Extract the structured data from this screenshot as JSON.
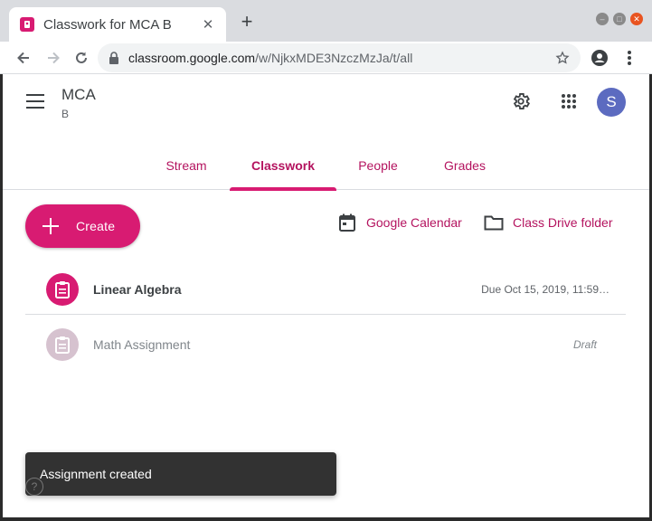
{
  "browser": {
    "tab_title": "Classwork for MCA B",
    "url_domain": "classroom.google.com",
    "url_path": "/w/NjkxMDE3NzczMzJa/t/all"
  },
  "header": {
    "class_name": "MCA",
    "section": "B",
    "avatar_initial": "S"
  },
  "nav_tabs": [
    {
      "label": "Stream"
    },
    {
      "label": "Classwork",
      "active": true
    },
    {
      "label": "People"
    },
    {
      "label": "Grades"
    }
  ],
  "actions": {
    "create_label": "Create",
    "calendar_label": "Google Calendar",
    "drive_label": "Class Drive folder"
  },
  "classwork_items": [
    {
      "title": "Linear Algebra",
      "meta": "Due Oct 15, 2019, 11:59…"
    },
    {
      "title": "Math Assignment",
      "meta": "Draft"
    }
  ],
  "snackbar": {
    "message": "Assignment created"
  },
  "colors": {
    "accent": "#d81b72",
    "accent_text": "#b4135f",
    "avatar": "#5c6bc0",
    "snackbar": "#323232"
  },
  "icons": [
    "hamburger-icon",
    "gear-icon",
    "apps-grid-icon",
    "calendar-icon",
    "folder-icon",
    "assignment-icon",
    "help-icon",
    "lock-icon",
    "star-icon",
    "account-icon",
    "menu-dots-icon"
  ]
}
